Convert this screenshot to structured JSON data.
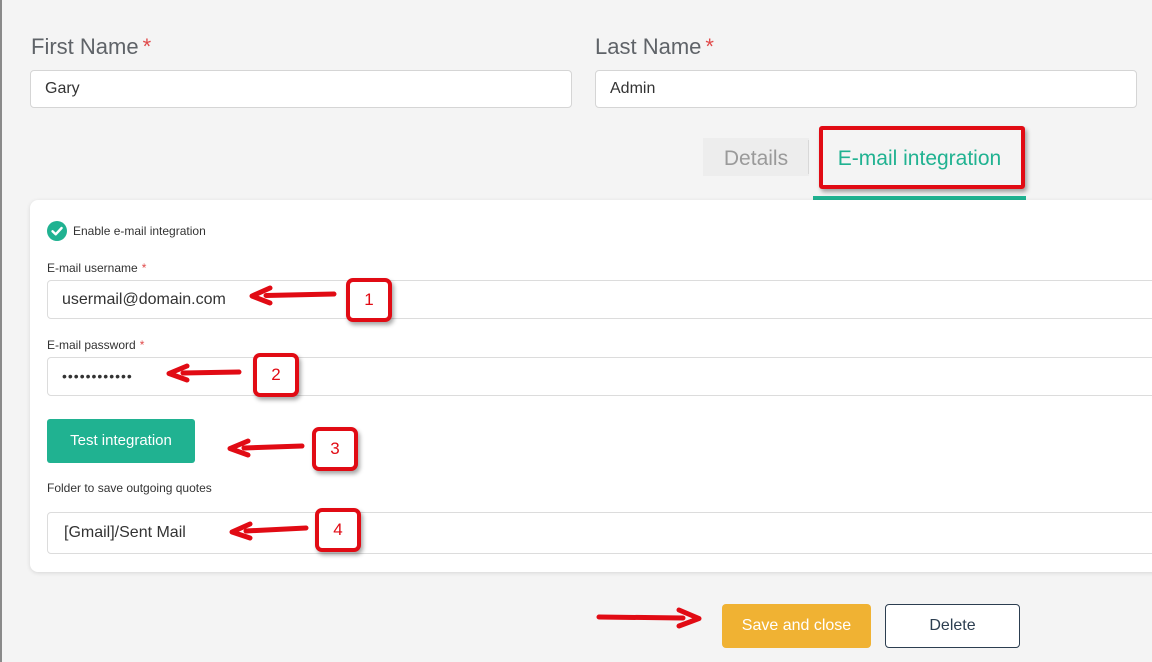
{
  "form": {
    "first_name_label": "First Name",
    "last_name_label": "Last Name",
    "required_marker": "*",
    "first_name_value": "Gary",
    "last_name_value": "Admin"
  },
  "tabs": [
    {
      "label": "Details",
      "active": false
    },
    {
      "label": "E-mail integration",
      "active": true
    }
  ],
  "email_panel": {
    "enable_label": "Enable e-mail integration",
    "enabled": true,
    "username_label": "E-mail username",
    "username_value": "usermail@domain.com",
    "password_label": "E-mail password",
    "password_value": "••••••••••••",
    "test_button": "Test integration",
    "folder_label": "Folder to save outgoing quotes",
    "folder_value": "[Gmail]/Sent Mail"
  },
  "actions": {
    "save_close": "Save and close",
    "delete": "Delete"
  },
  "callouts": [
    "1",
    "2",
    "3",
    "4"
  ],
  "colors": {
    "accent": "#20b291",
    "save": "#f0b233",
    "annotation": "#e10b14",
    "required": "#e04a4a"
  }
}
